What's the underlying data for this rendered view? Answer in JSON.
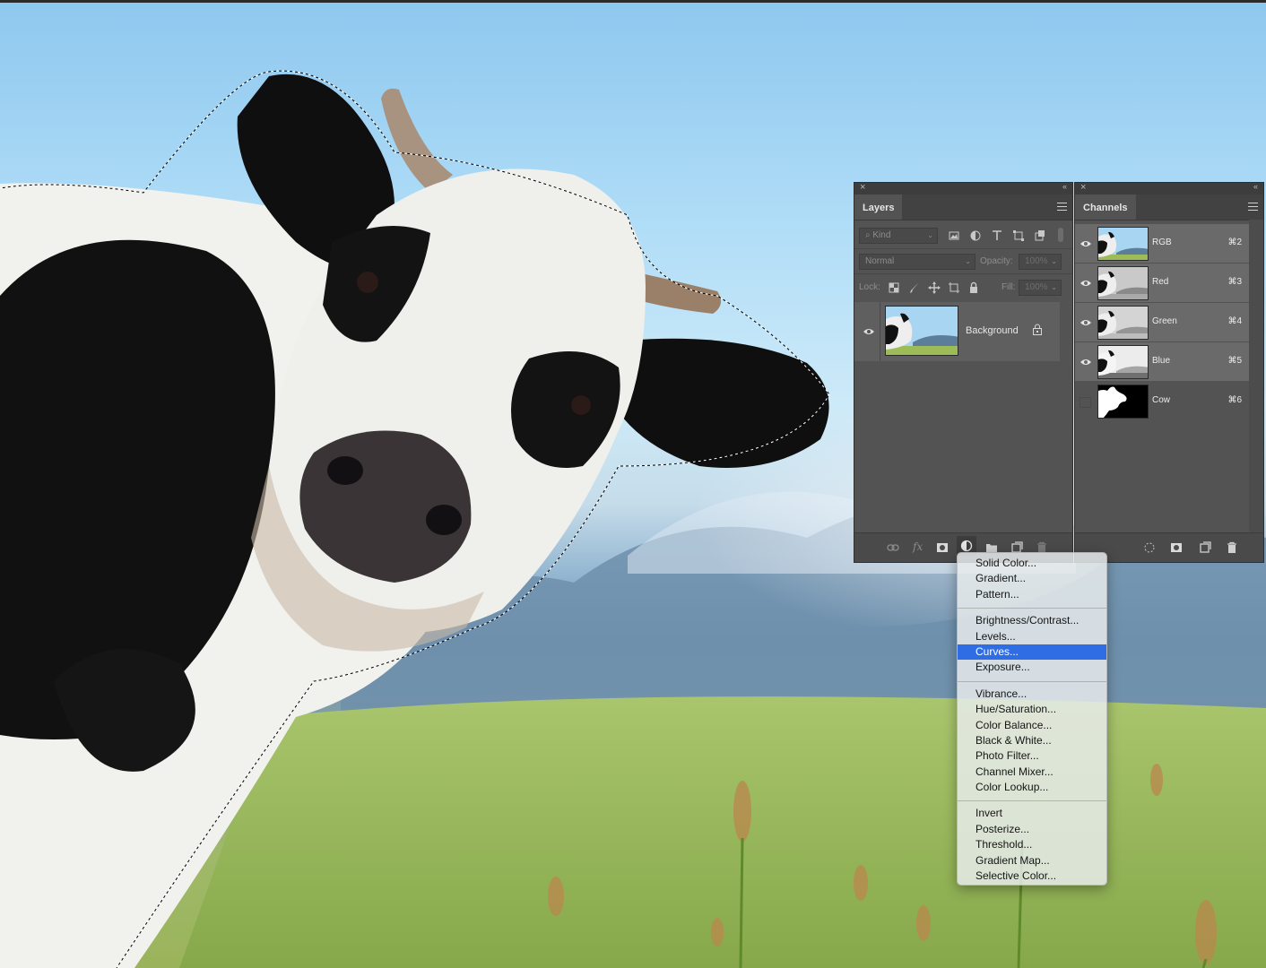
{
  "layers_panel": {
    "tab_label": "Layers",
    "filter": {
      "kind_label": "Kind"
    },
    "blend_mode": "Normal",
    "opacity": {
      "label": "Opacity:",
      "value": "100%"
    },
    "lock": {
      "label": "Lock:"
    },
    "fill": {
      "label": "Fill:",
      "value": "100%"
    },
    "layers": [
      {
        "name": "Background",
        "locked": true,
        "visible": true
      }
    ],
    "bottom_icons": [
      "link-icon",
      "fx-icon",
      "mask-icon",
      "adjustment-icon",
      "folder-icon",
      "new-layer-icon",
      "trash-icon"
    ]
  },
  "channels_panel": {
    "tab_label": "Channels",
    "channels": [
      {
        "name": "RGB",
        "shortcut": "⌘2",
        "visible": true,
        "selected": true
      },
      {
        "name": "Red",
        "shortcut": "⌘3",
        "visible": true,
        "selected": true
      },
      {
        "name": "Green",
        "shortcut": "⌘4",
        "visible": true,
        "selected": true
      },
      {
        "name": "Blue",
        "shortcut": "⌘5",
        "visible": true,
        "selected": true
      },
      {
        "name": "Cow",
        "shortcut": "⌘6",
        "visible": false,
        "selected": false
      }
    ],
    "bottom_icons": [
      "load-selection-icon",
      "save-selection-icon",
      "new-channel-icon",
      "trash-icon"
    ]
  },
  "adjustment_menu": {
    "groups": [
      [
        "Solid Color...",
        "Gradient...",
        "Pattern..."
      ],
      [
        "Brightness/Contrast...",
        "Levels...",
        "Curves...",
        "Exposure..."
      ],
      [
        "Vibrance...",
        "Hue/Saturation...",
        "Color Balance...",
        "Black & White...",
        "Photo Filter...",
        "Channel Mixer...",
        "Color Lookup..."
      ],
      [
        "Invert",
        "Posterize...",
        "Threshold...",
        "Gradient Map...",
        "Selective Color..."
      ]
    ],
    "highlighted": "Curves..."
  },
  "colors": {
    "panel_bg": "#535353",
    "menu_highlight": "#2f6de5",
    "sky_top": "#8ec7ee",
    "grass": "#9bb45b"
  }
}
